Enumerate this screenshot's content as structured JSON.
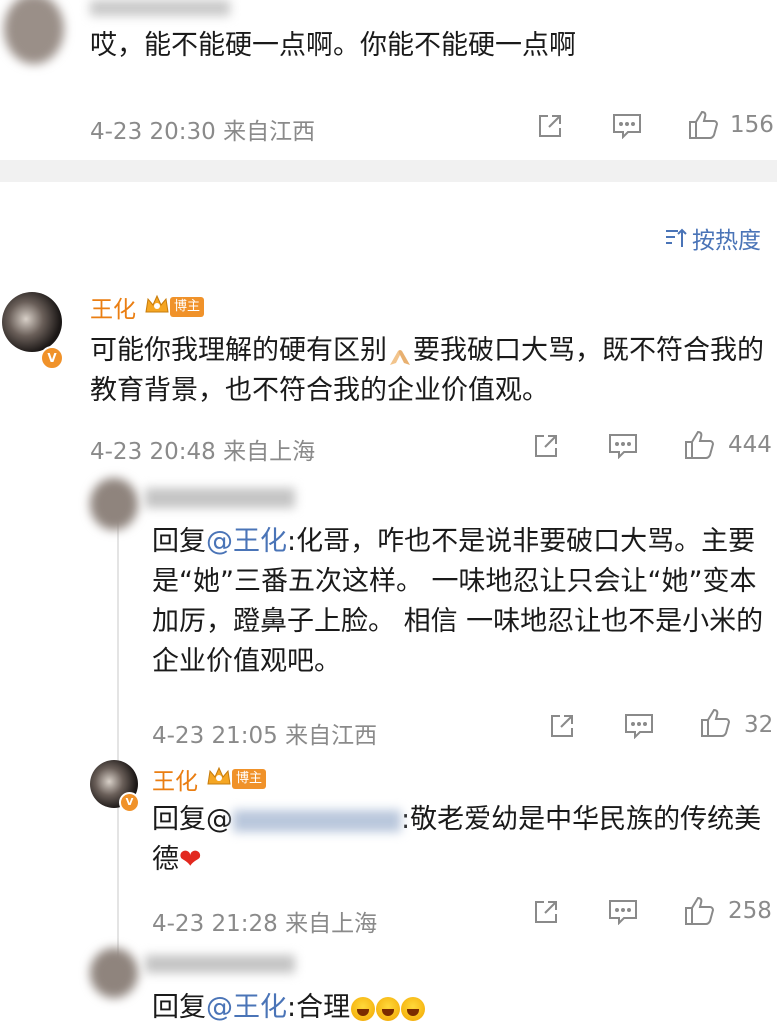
{
  "comment_top": {
    "text": "哎，能不能硬一点啊。你能不能硬一点啊",
    "meta": "4-23 20:30 来自江西",
    "likes": "156"
  },
  "sort_label": "按热度",
  "main_comment": {
    "author": "王化",
    "badge": "博主",
    "text_part1": "可能你我理解的硬有区别",
    "text_part2": "要我破口大骂，既不符合我的教育背景，也不符合我的企业价值观。",
    "meta": "4-23 20:48 来自上海",
    "likes": "444"
  },
  "reply1": {
    "prefix": "回复",
    "mention": "@王化",
    "text": ":化哥，咋也不是说非要破口大骂。主要是“她”三番五次这样。  一味地忍让只会让“她”变本加厉，蹬鼻子上脸。 相信 一味地忍让也不是小米的企业价值观吧。",
    "meta": "4-23 21:05 来自江西",
    "likes": "32"
  },
  "reply2": {
    "author": "王化",
    "badge": "博主",
    "prefix": "回复@",
    "text": ":敬老爱幼是中华民族的传统美德",
    "meta": "4-23 21:28 来自上海",
    "likes": "258"
  },
  "reply3": {
    "prefix": "回复",
    "mention": "@王化",
    "text": ":合理"
  },
  "colors": {
    "link": "#4a74b7",
    "name": "#ea7e12",
    "meta": "#8a8a8a"
  }
}
